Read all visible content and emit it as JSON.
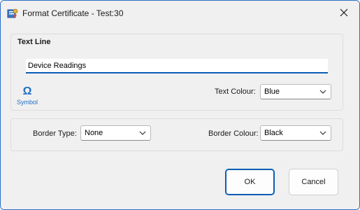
{
  "window": {
    "title": "Format Certificate - Test:30",
    "app_icon": "certificate-icon",
    "close_icon": "close-icon"
  },
  "text_line": {
    "group_title": "Text Line",
    "value": "Device Readings",
    "symbol_glyph": "Ω",
    "symbol_label": "Symbol",
    "text_colour_label": "Text Colour:",
    "text_colour_value": "Blue"
  },
  "border": {
    "type_label": "Border Type:",
    "type_value": "None",
    "colour_label": "Border Colour:",
    "colour_value": "Black"
  },
  "buttons": {
    "ok": "OK",
    "cancel": "Cancel"
  },
  "colors": {
    "accent": "#0a5db6",
    "symbol": "#1f6fc5"
  }
}
